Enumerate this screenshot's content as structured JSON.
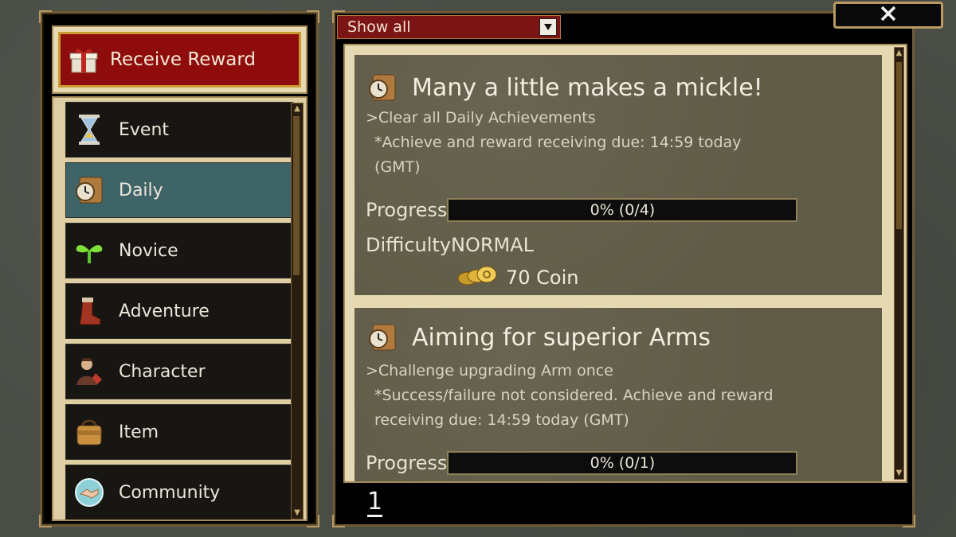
{
  "sidebar": {
    "receive_reward_label": "Receive Reward",
    "items": [
      {
        "label": "Event",
        "icon": "hourglass-icon"
      },
      {
        "label": "Daily",
        "icon": "clock-scroll-icon",
        "active": true
      },
      {
        "label": "Novice",
        "icon": "sprout-icon"
      },
      {
        "label": "Adventure",
        "icon": "boot-icon"
      },
      {
        "label": "Character",
        "icon": "character-icon"
      },
      {
        "label": "Item",
        "icon": "bag-icon"
      },
      {
        "label": "Community",
        "icon": "handshake-icon"
      }
    ]
  },
  "filter": {
    "selected": "Show all"
  },
  "close_label": "✕",
  "achievements": [
    {
      "title": "Many a little makes a mickle!",
      "description": ">Clear all Daily Achievements",
      "note": "*Achieve and reward receiving due: 14:59 today (GMT)",
      "progress_label": "Progress",
      "progress_text": "0% (0/4)",
      "progress_fraction": 0,
      "difficulty": "DifficultyNORMAL",
      "reward": "70 Coin"
    },
    {
      "title": "Aiming for superior Arms",
      "description": ">Challenge upgrading Arm once",
      "note": "*Success/failure not considered. Achieve and reward receiving due: 14:59 today (GMT)",
      "progress_label": "Progress",
      "progress_text": "0% (0/1)",
      "progress_fraction": 0
    }
  ],
  "pagination": {
    "current": "1"
  },
  "colors": {
    "reward_button": "#8f0c0c",
    "active_item": "#3f6467",
    "filter_bg": "#7b1414",
    "card_bg": "#605c48"
  }
}
